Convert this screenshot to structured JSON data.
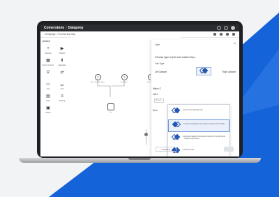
{
  "app": {
    "brand_a": "Comerstone",
    "brand_b": "Dataprep"
  },
  "breadcrumb": "Homepage  >  Process flow step",
  "actions": {
    "title": "Actions",
    "tools": [
      {
        "label": "Add step",
        "glyph": "+",
        "icon": "plus-icon"
      },
      {
        "label": "Product",
        "glyph": "▶",
        "icon": "play-icon"
      },
      {
        "label": "Select columns",
        "glyph": "▦",
        "icon": "grid-icon"
      },
      {
        "label": "Aggregate",
        "glyph": "⬆",
        "icon": "aggregate-icon"
      },
      {
        "label": "",
        "glyph": "⚲",
        "icon": "search-icon"
      },
      {
        "label": "",
        "glyph": "⇄",
        "icon": "swap-icon"
      },
      {
        "label": "Join",
        "glyph": "▭",
        "icon": "join-icon"
      },
      {
        "label": "Sort",
        "glyph": "AZ",
        "icon": "sort-icon"
      },
      {
        "label": "Filter",
        "glyph": "▤",
        "icon": "filter-icon"
      },
      {
        "label": "Pivoting",
        "glyph": "≡",
        "icon": "pivot-icon"
      },
      {
        "label": "Output",
        "glyph": "▣",
        "icon": "output-icon"
      }
    ]
  },
  "canvas": {
    "nodes": [
      {
        "label": "Input - Monthly Sales"
      },
      {
        "label": "Test Input 1"
      },
      {
        "label": "Cleansing 2"
      },
      {
        "label": "Join"
      }
    ]
  },
  "panel": {
    "title": "Join",
    "question": "Choose type of join and match keys...",
    "join_type_label": "Join Type",
    "left_dataset": "Left Dataset",
    "right_dataset": "Right Dataset",
    "selected_join": "Inner join",
    "side_label_1": "Match C",
    "side_label_2": "Left c",
    "side_label_3": "Unm",
    "side_placeholder": "Placeho",
    "options": [
      {
        "name": "Inner join",
        "desc": "Include only matching rows",
        "venn": "fill-inner"
      },
      {
        "name": "Left join",
        "desc": "Include all matching rows and all rows from the left table",
        "venn": "fill-l"
      },
      {
        "name": "Right join",
        "desc": "Include all matching rows and all rows from the right table",
        "venn": "fill-r"
      },
      {
        "name": "Outer join",
        "desc": "Include all rows",
        "venn": "fill-all"
      }
    ],
    "footer_link": "Create match keys",
    "previous_button": "Prev/next",
    "apply_button": ""
  },
  "colors": {
    "accent": "#2457b4",
    "stripe": "#1463d8"
  }
}
